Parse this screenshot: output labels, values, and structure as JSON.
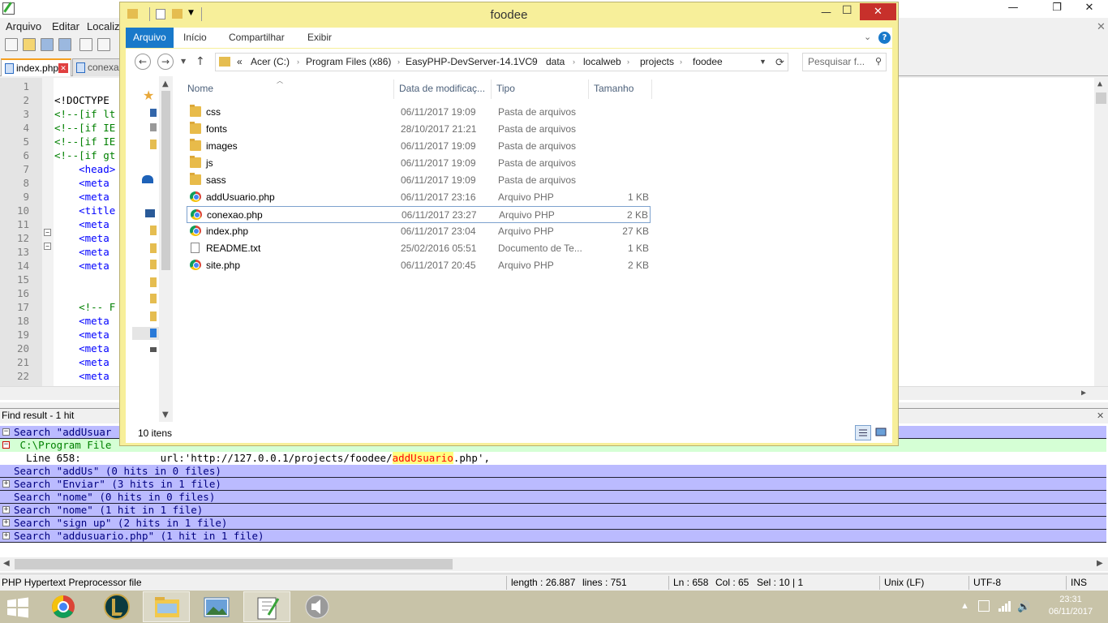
{
  "npp": {
    "menu": [
      "Arquivo",
      "Editar",
      "Localiza"
    ],
    "tabs": [
      {
        "label": "index.php"
      },
      {
        "label": "conexao"
      }
    ],
    "code_lines": [
      {
        "n": "1",
        "text": ""
      },
      {
        "n": "2",
        "text": "<!DOCTYPE"
      },
      {
        "n": "3",
        "text": "<!--[if lt"
      },
      {
        "n": "4",
        "text": "<!--[if IE"
      },
      {
        "n": "5",
        "text": "<!--[if IE"
      },
      {
        "n": "6",
        "text": "<!--[if gt"
      },
      {
        "n": "7",
        "text": "    <head>"
      },
      {
        "n": "8",
        "text": "    <meta"
      },
      {
        "n": "9",
        "text": "    <meta"
      },
      {
        "n": "10",
        "text": "    <title"
      },
      {
        "n": "11",
        "text": "    <meta"
      },
      {
        "n": "12",
        "text": "    <meta"
      },
      {
        "n": "13",
        "text": "    <meta"
      },
      {
        "n": "14",
        "text": "    <meta"
      },
      {
        "n": "15",
        "text": ""
      },
      {
        "n": "16",
        "text": ""
      },
      {
        "n": "17",
        "text": "    <!-- F"
      },
      {
        "n": "18",
        "text": "    <meta"
      },
      {
        "n": "19",
        "text": "    <meta"
      },
      {
        "n": "20",
        "text": "    <meta"
      },
      {
        "n": "21",
        "text": "    <meta"
      },
      {
        "n": "22",
        "text": "    <meta"
      }
    ],
    "find": {
      "title": "Find result - 1 hit",
      "rows": [
        {
          "kind": "search",
          "text": "Search \"addUsuar",
          "toggle": "−"
        },
        {
          "kind": "file",
          "text": " C:\\Program File",
          "toggle": "−"
        },
        {
          "kind": "line",
          "pre": "  Line 658:             url:'http://127.0.0.1/projects/foodee/",
          "hit": "addUsuario",
          "post": ".php',"
        },
        {
          "kind": "search",
          "text": "Search \"addUs\" (0 hits in 0 files)",
          "toggle": ""
        },
        {
          "kind": "search",
          "text": "Search \"Enviar\" (3 hits in 1 file)",
          "toggle": "+"
        },
        {
          "kind": "search",
          "text": "Search \"nome\" (0 hits in 0 files)",
          "toggle": ""
        },
        {
          "kind": "search",
          "text": "Search \"nome\" (1 hit in 1 file)",
          "toggle": "+"
        },
        {
          "kind": "search",
          "text": "Search \"sign up\" (2 hits in 1 file)",
          "toggle": "+"
        },
        {
          "kind": "search",
          "text": "Search \"addusuario.php\" (1 hit in 1 file)",
          "toggle": "+"
        }
      ]
    },
    "status": {
      "filetype": "PHP Hypertext Preprocessor file",
      "length": "length : 26.887",
      "lines": "lines : 751",
      "ln": "Ln : 658",
      "col": "Col : 65",
      "sel": "Sel : 10 | 1",
      "eol": "Unix (LF)",
      "enc": "UTF-8",
      "ins": "INS"
    }
  },
  "explorer": {
    "title": "foodee",
    "ribbon_tabs": [
      "Arquivo",
      "Início",
      "Compartilhar",
      "Exibir"
    ],
    "breadcrumb": [
      "«",
      "Acer (C:)",
      "Program Files (x86)",
      "EasyPHP-DevServer-14.1VC9",
      "data",
      "localweb",
      "projects",
      "foodee"
    ],
    "search_placeholder": "Pesquisar f...",
    "columns": {
      "name": "Nome",
      "date": "Data de modificaç...",
      "type": "Tipo",
      "size": "Tamanho"
    },
    "files": [
      {
        "name": "css",
        "date": "06/11/2017 19:09",
        "type": "Pasta de arquivos",
        "size": "",
        "icon": "folder"
      },
      {
        "name": "fonts",
        "date": "28/10/2017 21:21",
        "type": "Pasta de arquivos",
        "size": "",
        "icon": "folder"
      },
      {
        "name": "images",
        "date": "06/11/2017 19:09",
        "type": "Pasta de arquivos",
        "size": "",
        "icon": "folder"
      },
      {
        "name": "js",
        "date": "06/11/2017 19:09",
        "type": "Pasta de arquivos",
        "size": "",
        "icon": "folder"
      },
      {
        "name": "sass",
        "date": "06/11/2017 19:09",
        "type": "Pasta de arquivos",
        "size": "",
        "icon": "folder"
      },
      {
        "name": "addUsuario.php",
        "date": "06/11/2017 23:16",
        "type": "Arquivo PHP",
        "size": "1 KB",
        "icon": "chrome"
      },
      {
        "name": "conexao.php",
        "date": "06/11/2017 23:27",
        "type": "Arquivo PHP",
        "size": "2 KB",
        "icon": "chrome",
        "selected": true
      },
      {
        "name": "index.php",
        "date": "06/11/2017 23:04",
        "type": "Arquivo PHP",
        "size": "27 KB",
        "icon": "chrome"
      },
      {
        "name": "README.txt",
        "date": "25/02/2016 05:51",
        "type": "Documento de Te...",
        "size": "1 KB",
        "icon": "txt"
      },
      {
        "name": "site.php",
        "date": "06/11/2017 20:45",
        "type": "Arquivo PHP",
        "size": "2 KB",
        "icon": "chrome"
      }
    ],
    "item_count": "10 itens"
  },
  "taskbar": {
    "time": "23:31",
    "date": "06/11/2017"
  }
}
